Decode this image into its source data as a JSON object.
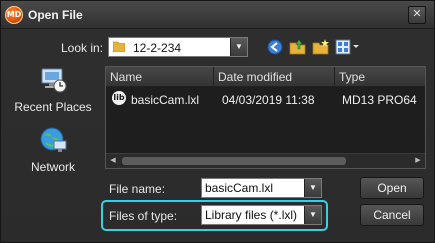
{
  "window": {
    "title": "Open File",
    "app_logo_text": "MD",
    "close_symbol": "✕"
  },
  "lookin": {
    "label": "Look in:",
    "value": "12-2-234"
  },
  "toolbar": {
    "back_icon": "back-arrow-icon",
    "up_icon": "up-folder-icon",
    "new_folder_icon": "new-folder-icon",
    "view_icon": "view-menu-icon"
  },
  "places": [
    {
      "label": "Recent Places",
      "icon": "recent-places-icon"
    },
    {
      "label": "Network",
      "icon": "network-icon"
    }
  ],
  "filelist": {
    "columns": [
      "Name",
      "Date modified",
      "Type"
    ],
    "rows": [
      {
        "icon_text": "lib",
        "name": "basicCam.lxl",
        "date": "04/03/2019 11:38",
        "type": "MD13 PRO64"
      }
    ]
  },
  "form": {
    "filename_label": "File name:",
    "filename_value": "basicCam.lxl",
    "filetype_label": "Files of type:",
    "filetype_value": "Library files (*.lxl)"
  },
  "buttons": {
    "open": "Open",
    "cancel": "Cancel"
  },
  "colors": {
    "highlight": "#35d0e8",
    "background": "#2b2b2b"
  }
}
